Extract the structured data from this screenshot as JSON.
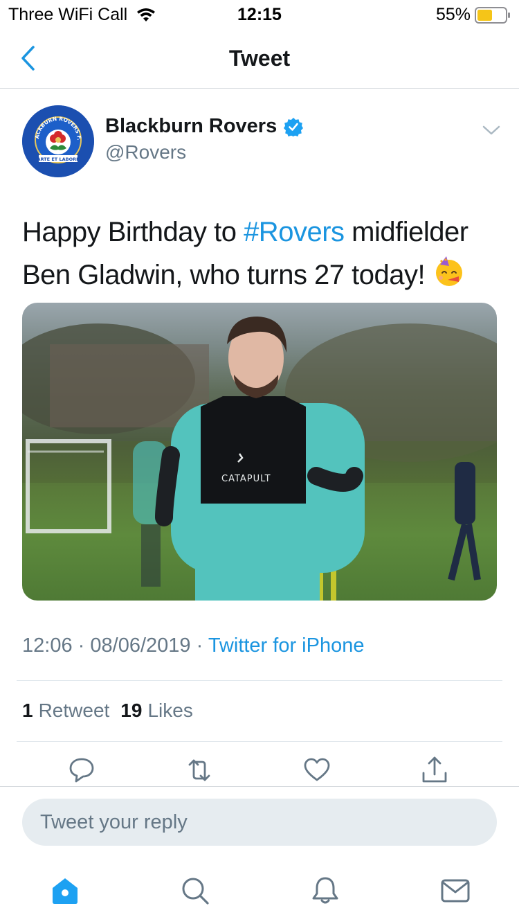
{
  "status_bar": {
    "carrier": "Three WiFi Call",
    "time": "12:15",
    "battery": "55%",
    "battery_level": 0.55,
    "battery_color": "#f5c518"
  },
  "nav": {
    "title": "Tweet",
    "back_icon": "chevron-left-icon"
  },
  "tweet": {
    "author_name": "Blackburn Rovers",
    "author_handle": "@Rovers",
    "verified": true,
    "text_part1": "Happy Birthday to ",
    "hashtag": "#Rovers",
    "text_part2": " midfielder Ben Gladwin, who turns 27 today! ",
    "emoji": "partying-face-icon",
    "photo_brand_text": "CATAPULT",
    "crest_text_top": "BLACKBURN ROVERS F.C.",
    "crest_text_bottom": "ARTE ET LABORE",
    "time": "12:06",
    "date": "08/06/2019",
    "separator": "·",
    "source": "Twitter for iPhone",
    "retweets_count": "1",
    "retweets_label": "Retweet",
    "likes_count": "19",
    "likes_label": "Likes"
  },
  "actions": [
    "reply-icon",
    "retweet-icon",
    "like-icon",
    "share-icon"
  ],
  "reply": {
    "placeholder": "Tweet your reply"
  },
  "tabs": [
    "home-icon",
    "search-icon",
    "notifications-icon",
    "messages-icon"
  ],
  "colors": {
    "accent": "#1b95e0",
    "text": "#14171a",
    "secondary": "#657786",
    "icon": "#657786"
  }
}
